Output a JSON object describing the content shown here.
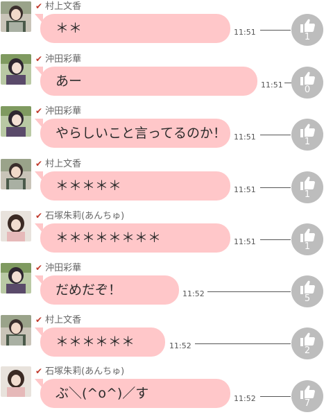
{
  "messages": [
    {
      "sender": "村上文香",
      "text": "＊＊",
      "time": "11:51",
      "likes": "1",
      "avatar": "person-photo-1"
    },
    {
      "sender": "沖田彩華",
      "text": "あー",
      "time": "11:51",
      "likes": "0",
      "avatar": "person-photo-2"
    },
    {
      "sender": "沖田彩華",
      "text": "やらしいこと言ってるのか！",
      "time": "11:51",
      "likes": "1",
      "avatar": "person-photo-2"
    },
    {
      "sender": "村上文香",
      "text": "＊＊＊＊＊",
      "time": "11:51",
      "likes": "1",
      "avatar": "person-photo-1"
    },
    {
      "sender": "石塚朱莉(あんちゅ)",
      "text": "＊＊＊＊＊＊＊＊",
      "time": "11:51",
      "likes": "1",
      "avatar": "person-photo-3"
    },
    {
      "sender": "沖田彩華",
      "text": "だめだぞ！",
      "time": "11:52",
      "likes": "5",
      "avatar": "person-photo-2"
    },
    {
      "sender": "村上文香",
      "text": "＊＊＊＊＊＊",
      "time": "11:52",
      "likes": "2",
      "avatar": "person-photo-1"
    },
    {
      "sender": "石塚朱莉(あんちゅ)",
      "text": "ぶ＼(^o^)／す",
      "time": "11:52",
      "likes": "7",
      "avatar": "person-photo-3"
    }
  ],
  "colors": {
    "bubble": "#ffc7c9",
    "check": "#c0392b",
    "like_button": "#bdbdbd"
  },
  "icons": {
    "check": "check-icon",
    "like": "thumbs-up-icon"
  }
}
